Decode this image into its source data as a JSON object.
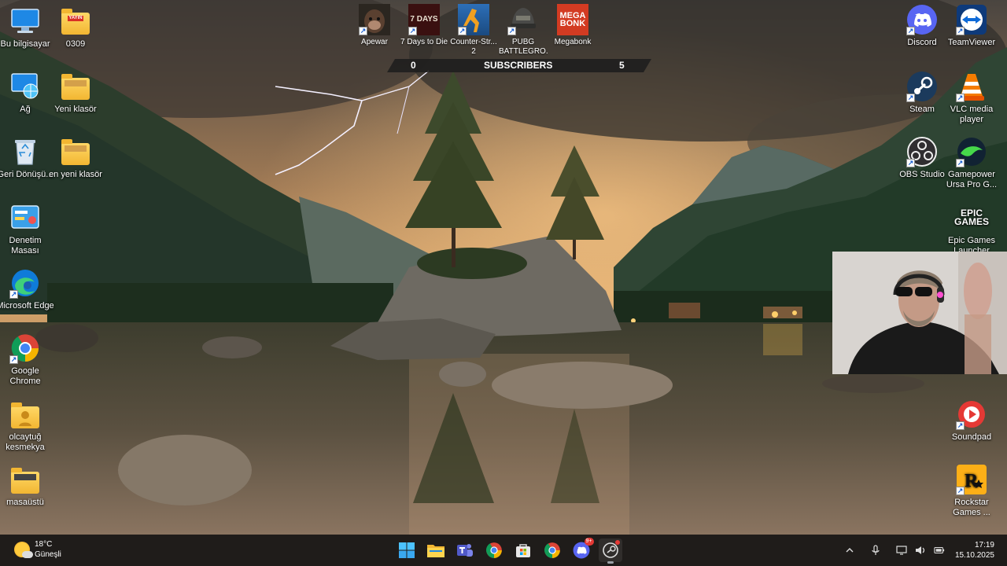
{
  "desktop": {
    "left_col1": [
      {
        "label": "Bu bilgisayar",
        "icon": "monitor-icon"
      },
      {
        "label": "Ağ",
        "icon": "network-globe-icon"
      },
      {
        "label": "Geri Dönüşü...",
        "icon": "recycle-bin-icon"
      },
      {
        "label": "Denetim Masası",
        "icon": "control-panel-icon"
      },
      {
        "label": "Microsoft Edge",
        "icon": "edge-icon"
      },
      {
        "label": "Google Chrome",
        "icon": "chrome-icon"
      },
      {
        "label": "olcaytuğ kesmekya",
        "icon": "user-folder-icon"
      },
      {
        "label": "masaüstü",
        "icon": "folder-icon"
      }
    ],
    "left_col2": [
      {
        "label": "0309",
        "icon": "folder-icon",
        "tag": "YAYIN"
      },
      {
        "label": "Yeni klasör",
        "icon": "folder-icon"
      },
      {
        "label": "en yeni klasör",
        "icon": "folder-icon"
      }
    ],
    "right_col1": [
      {
        "label": "Discord",
        "icon": "discord-icon"
      },
      {
        "label": "Steam",
        "icon": "steam-icon"
      },
      {
        "label": "OBS Studio",
        "icon": "obs-icon"
      }
    ],
    "right_col2": [
      {
        "label": "TeamViewer",
        "icon": "teamviewer-icon"
      },
      {
        "label": "VLC media player",
        "icon": "vlc-icon"
      },
      {
        "label": "Gamepower Ursa Pro G...",
        "icon": "gamepower-icon"
      },
      {
        "label": "Epic Games Launcher",
        "icon": "epic-games-icon",
        "logo": "EPIC GAMES"
      },
      {
        "label": "Soundpad",
        "icon": "soundpad-icon"
      },
      {
        "label": "Rockstar Games ...",
        "icon": "rockstar-icon"
      }
    ],
    "games": [
      {
        "label": "Apewar",
        "icon": "apewar-icon"
      },
      {
        "label": "7 Days to Die",
        "icon": "7days-icon",
        "logo": "7 DAYS"
      },
      {
        "label": "Counter-Str... 2",
        "icon": "counter-strike-icon"
      },
      {
        "label": "PUBG BATTLEGRO...",
        "icon": "pubg-icon"
      },
      {
        "label": "Megabonk",
        "icon": "megabonk-icon",
        "logo": "MEGA BONK"
      }
    ]
  },
  "subscribers": {
    "left": "0",
    "label": "SUBSCRIBERS",
    "right": "5"
  },
  "taskbar": {
    "weather": {
      "temp": "18°C",
      "condition": "Güneşli"
    },
    "apps": [
      "windows-start-icon",
      "file-explorer-icon",
      "teams-icon",
      "chrome-icon",
      "microsoft-store-icon",
      "chrome-icon",
      "discord-icon",
      "steam-alt-icon"
    ],
    "discord_badge": "9+",
    "clock": {
      "time": "17:19",
      "date": "15.10.2025"
    }
  },
  "colors": {
    "taskbar": "#1f1c1a",
    "accent": "#0078d4",
    "discord": "#5865f2"
  }
}
